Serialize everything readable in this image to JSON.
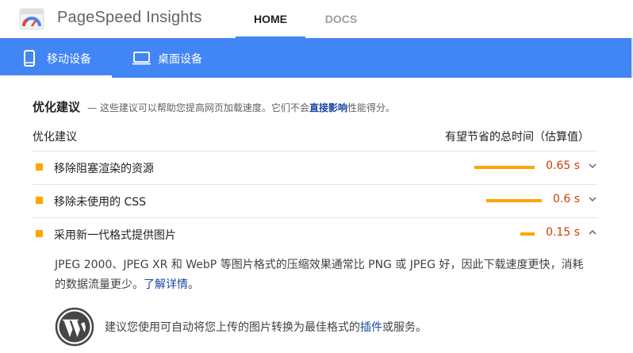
{
  "header": {
    "app_title": "PageSpeed Insights",
    "tabs": [
      {
        "label": "HOME",
        "active": true
      },
      {
        "label": "DOCS",
        "active": false
      }
    ]
  },
  "device_tabs": [
    {
      "label": "移动设备",
      "icon": "smartphone-icon",
      "active": true
    },
    {
      "label": "桌面设备",
      "icon": "desktop-monitor-icon",
      "active": false
    }
  ],
  "section": {
    "title": "优化建议",
    "desc_prefix": "— 这些建议可以帮助您提高网页加载速度。它们不会",
    "desc_link": "直接影响",
    "desc_suffix": "性能得分。"
  },
  "columns": {
    "left": "优化建议",
    "right": "有望节省的总时间（估算值）"
  },
  "audits": [
    {
      "title": "移除阻塞渲染的资源",
      "value": "0.65 s",
      "savings_seconds": 0.65,
      "expanded": false
    },
    {
      "title": "移除未使用的 CSS",
      "value": "0.6 s",
      "savings_seconds": 0.6,
      "expanded": false
    },
    {
      "title": "采用新一代格式提供图片",
      "value": "0.15 s",
      "savings_seconds": 0.15,
      "expanded": true
    }
  ],
  "detail": {
    "text": "JPEG 2000、JPEG XR 和 WebP 等图片格式的压缩效果通常比 PNG 或 JPEG 好，因此下载速度更快，消耗的数据流量更少。",
    "link": "了解详情",
    "suffix": "。"
  },
  "wordpress_tip": {
    "prefix": "建议您使用可自动将您上传的图片转换为最佳格式的",
    "link": "插件",
    "suffix": "或服务。"
  },
  "colors": {
    "primary": "#4285f4",
    "warning": "#ffa400",
    "value_text": "#d33c00",
    "link": "#1a47a6"
  }
}
